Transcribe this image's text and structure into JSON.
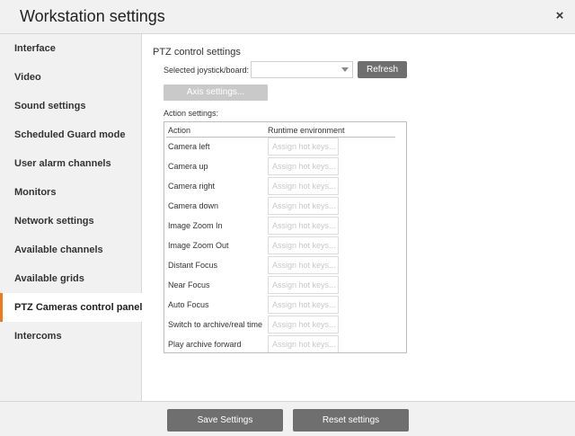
{
  "window": {
    "title": "Workstation settings",
    "close_icon": "×"
  },
  "sidebar": {
    "items": [
      {
        "label": "Interface"
      },
      {
        "label": "Video"
      },
      {
        "label": "Sound settings"
      },
      {
        "label": "Scheduled Guard mode"
      },
      {
        "label": "User alarm channels"
      },
      {
        "label": "Monitors"
      },
      {
        "label": "Network settings"
      },
      {
        "label": "Available channels"
      },
      {
        "label": "Available grids"
      },
      {
        "label": "PTZ Cameras control panel",
        "active": true
      },
      {
        "label": "Intercoms"
      }
    ]
  },
  "ptz": {
    "section_title": "PTZ control settings",
    "joystick_label": "Selected joystick/board:",
    "joystick_value": "",
    "refresh_label": "Refresh",
    "axis_settings_label": "Axis settings...",
    "action_settings_label": "Action settings:",
    "table": {
      "headers": {
        "action": "Action",
        "runtime": "Runtime environment"
      },
      "hotkey_placeholder": "Assign hot keys...",
      "rows": [
        {
          "action": "Camera left",
          "hotkey": "Assign hot keys..."
        },
        {
          "action": "Camera up",
          "hotkey": "Assign hot keys..."
        },
        {
          "action": "Camera right",
          "hotkey": "Assign hot keys..."
        },
        {
          "action": "Camera down",
          "hotkey": "Assign hot keys..."
        },
        {
          "action": "Image Zoom In",
          "hotkey": "Assign hot keys..."
        },
        {
          "action": "Image Zoom Out",
          "hotkey": "Assign hot keys..."
        },
        {
          "action": "Distant Focus",
          "hotkey": "Assign hot keys..."
        },
        {
          "action": "Near Focus",
          "hotkey": "Assign hot keys..."
        },
        {
          "action": "Auto Focus",
          "hotkey": "Assign hot keys..."
        },
        {
          "action": "Switch to archive/real time",
          "hotkey": "Assign hot keys..."
        },
        {
          "action": "Play archive forward",
          "hotkey": "Assign hot keys..."
        }
      ]
    }
  },
  "footer": {
    "save_label": "Save Settings",
    "reset_label": "Reset settings"
  },
  "colors": {
    "accent": "#f07a1a",
    "button": "#6f6f6f",
    "disabled_button": "#c9c9c9"
  }
}
